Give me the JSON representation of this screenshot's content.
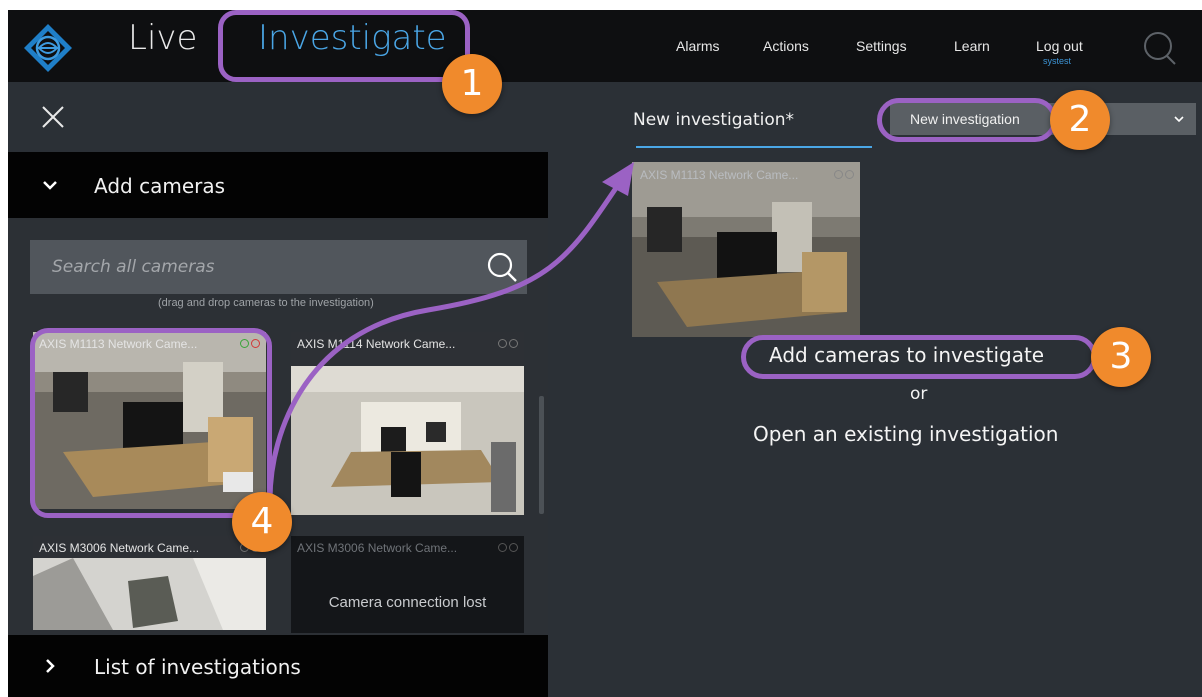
{
  "topbar": {
    "nav_live": "Live",
    "nav_investigate": "Investigate",
    "alarms": "Alarms",
    "actions": "Actions",
    "settings": "Settings",
    "learn": "Learn",
    "logout": "Log out",
    "logout_user": "systest",
    "accent": "#4aa6e6"
  },
  "left_panel": {
    "add_cameras_label": "Add cameras",
    "search_placeholder": "Search all cameras",
    "hint": "(drag and drop cameras to the investigation)",
    "cameras": [
      {
        "name": "AXIS M1113 Network Came...",
        "status": "online-selected"
      },
      {
        "name": "AXIS M1114 Network Came...",
        "status": "online"
      },
      {
        "name": "AXIS M3006 Network Came...",
        "status": "online"
      },
      {
        "name": "AXIS M3006 Network Came...",
        "status": "lost",
        "message": "Camera connection lost"
      }
    ],
    "list_investigations_label": "List of investigations"
  },
  "right_panel": {
    "tab_label": "New investigation*",
    "dropdown_value": "New investigation",
    "investigation_camera": "AXIS M1113 Network Came...",
    "msg_add": "Add cameras to investigate",
    "msg_or": "or",
    "msg_open": "Open an existing investigation"
  },
  "annotations": {
    "badge_1": "1",
    "badge_2": "2",
    "badge_3": "3",
    "badge_4": "4",
    "badge_color": "#f08a2c",
    "outline_color": "#9b62c4"
  }
}
